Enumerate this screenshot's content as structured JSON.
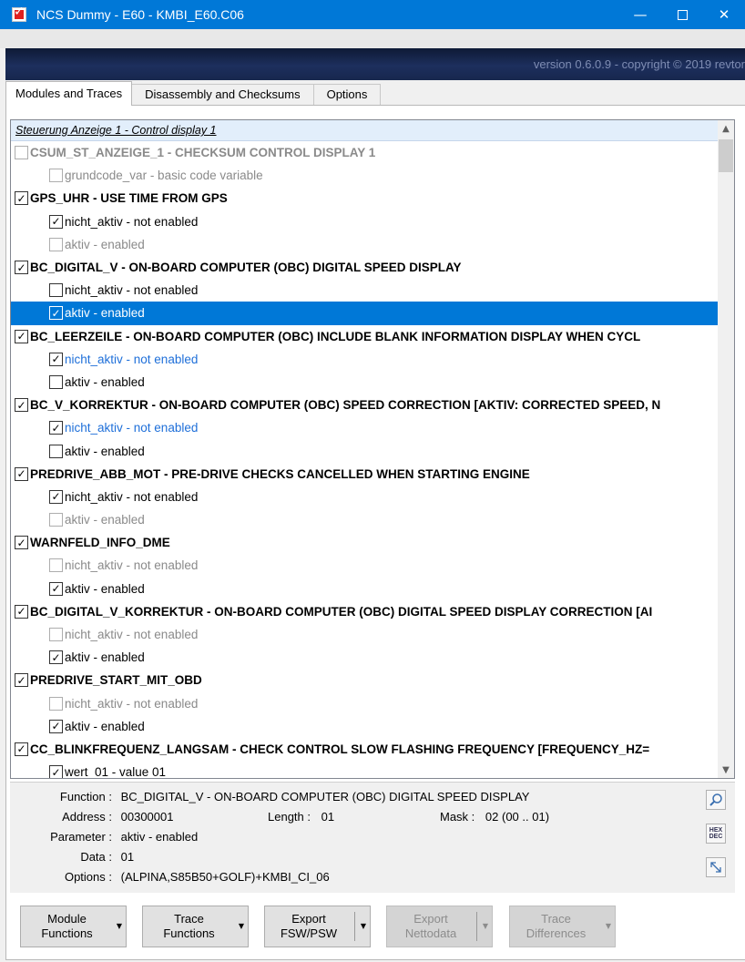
{
  "window": {
    "title": "NCS Dummy - E60 - KMBI_E60.C06",
    "minimize_glyph": "—",
    "close_glyph": "✕",
    "version_text": "version 0.6.0.9 - copyright © 2019 revtor"
  },
  "tabs": [
    {
      "label": "Modules and Traces",
      "active": true
    },
    {
      "label": "Disassembly and Checksums",
      "active": false
    },
    {
      "label": "Options",
      "active": false
    }
  ],
  "tree": {
    "header": "Steuerung Anzeige 1  -  Control display 1",
    "rows": [
      {
        "level": 0,
        "checked": false,
        "style": "gray",
        "text": "CSUM_ST_ANZEIGE_1  -  CHECKSUM CONTROL DISPLAY 1"
      },
      {
        "level": 1,
        "checked": false,
        "style": "gray",
        "text": "grundcode_var  -  basic code variable"
      },
      {
        "level": 0,
        "checked": true,
        "style": "normal",
        "text": "GPS_UHR  -  USE TIME FROM GPS"
      },
      {
        "level": 1,
        "checked": true,
        "style": "normal",
        "text": "nicht_aktiv  -  not enabled"
      },
      {
        "level": 1,
        "checked": false,
        "style": "gray",
        "text": "aktiv  -  enabled"
      },
      {
        "level": 0,
        "checked": true,
        "style": "normal",
        "text": "BC_DIGITAL_V  -  ON-BOARD COMPUTER (OBC) DIGITAL SPEED DISPLAY"
      },
      {
        "level": 1,
        "checked": false,
        "style": "normal",
        "text": "nicht_aktiv  -  not enabled"
      },
      {
        "level": 1,
        "checked": true,
        "style": "selected",
        "text": "aktiv  -  enabled"
      },
      {
        "level": 0,
        "checked": true,
        "style": "normal",
        "text": "BC_LEERZEILE  -  ON-BOARD COMPUTER (OBC) INCLUDE BLANK INFORMATION DISPLAY WHEN CYCL"
      },
      {
        "level": 1,
        "checked": true,
        "style": "blue",
        "text": "nicht_aktiv  -  not enabled"
      },
      {
        "level": 1,
        "checked": false,
        "style": "normal",
        "text": "aktiv  -  enabled"
      },
      {
        "level": 0,
        "checked": true,
        "style": "normal",
        "text": "BC_V_KORREKTUR  -  ON-BOARD COMPUTER (OBC) SPEED CORRECTION [AKTIV: CORRECTED SPEED, N"
      },
      {
        "level": 1,
        "checked": true,
        "style": "blue",
        "text": "nicht_aktiv  -  not enabled"
      },
      {
        "level": 1,
        "checked": false,
        "style": "normal",
        "text": "aktiv  -  enabled"
      },
      {
        "level": 0,
        "checked": true,
        "style": "normal",
        "text": "PREDRIVE_ABB_MOT  -  PRE-DRIVE CHECKS CANCELLED WHEN STARTING ENGINE"
      },
      {
        "level": 1,
        "checked": true,
        "style": "normal",
        "text": "nicht_aktiv  -  not enabled"
      },
      {
        "level": 1,
        "checked": false,
        "style": "gray",
        "text": "aktiv  -  enabled"
      },
      {
        "level": 0,
        "checked": true,
        "style": "normal",
        "text": "WARNFELD_INFO_DME"
      },
      {
        "level": 1,
        "checked": false,
        "style": "gray",
        "text": "nicht_aktiv  -  not enabled"
      },
      {
        "level": 1,
        "checked": true,
        "style": "normal",
        "text": "aktiv  -  enabled"
      },
      {
        "level": 0,
        "checked": true,
        "style": "normal",
        "text": "BC_DIGITAL_V_KORREKTUR  -  ON-BOARD COMPUTER (OBC) DIGITAL SPEED DISPLAY CORRECTION [AI"
      },
      {
        "level": 1,
        "checked": false,
        "style": "gray",
        "text": "nicht_aktiv  -  not enabled"
      },
      {
        "level": 1,
        "checked": true,
        "style": "normal",
        "text": "aktiv  -  enabled"
      },
      {
        "level": 0,
        "checked": true,
        "style": "normal",
        "text": "PREDRIVE_START_MIT_OBD"
      },
      {
        "level": 1,
        "checked": false,
        "style": "gray",
        "text": "nicht_aktiv  -  not enabled"
      },
      {
        "level": 1,
        "checked": true,
        "style": "normal",
        "text": "aktiv  -  enabled"
      },
      {
        "level": 0,
        "checked": true,
        "style": "normal",
        "text": "CC_BLINKFREQUENZ_LANGSAM  -  CHECK CONTROL SLOW FLASHING FREQUENCY [FREQUENCY_HZ="
      },
      {
        "level": 1,
        "checked": true,
        "style": "normal",
        "text": "wert_01  -  value 01"
      }
    ]
  },
  "details": {
    "function_label": "Function :",
    "function_value": "BC_DIGITAL_V  -  ON-BOARD COMPUTER (OBC) DIGITAL SPEED DISPLAY",
    "address_label": "Address :",
    "address_value": "00300001",
    "length_label": "Length :",
    "length_value": "01",
    "mask_label": "Mask :",
    "mask_value": "02  (00 .. 01)",
    "parameter_label": "Parameter :",
    "parameter_value": "aktiv  -  enabled",
    "data_label": "Data :",
    "data_value": "01",
    "options_label": "Options :",
    "options_value": "(ALPINA,S85B50+GOLF)+KMBI_CI_06",
    "hex_label": "HEX",
    "dec_label": "DEC"
  },
  "buttons": {
    "module_functions": {
      "line1": "Module",
      "line2": "Functions"
    },
    "trace_functions": {
      "line1": "Trace",
      "line2": "Functions"
    },
    "export_fsw": {
      "line1": "Export",
      "line2": "FSW/PSW"
    },
    "export_netto": {
      "line1": "Export",
      "line2": "Nettodata"
    },
    "trace_differences": {
      "line1": "Trace",
      "line2": "Differences"
    }
  },
  "colors": {
    "titlebar": "#0078d7",
    "selection": "#0078d7",
    "highlight_text": "#1e6fd9",
    "disabled_text": "#8a8a8a"
  }
}
